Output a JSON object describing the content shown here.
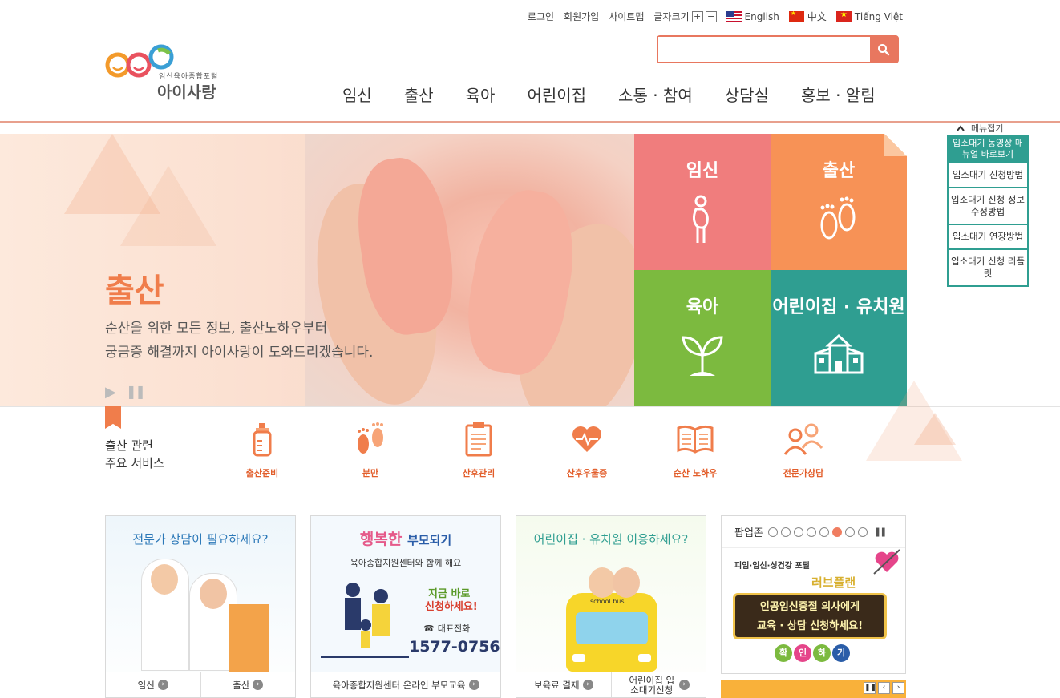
{
  "util": {
    "login": "로그인",
    "signup": "회원가입",
    "sitemap": "사이트맵",
    "fontsize_label": "글자크기",
    "fontsize_plus": "+",
    "fontsize_minus": "−",
    "lang_en": "English",
    "lang_zh": "中文",
    "lang_vi": "Tiếng Việt"
  },
  "search": {
    "placeholder": ""
  },
  "logo": {
    "sub": "임신육아종합포털",
    "name": "아이사랑"
  },
  "gnb": [
    "임신",
    "출산",
    "육아",
    "어린이집",
    "소통 · 참여",
    "상담실",
    "홍보 · 알림"
  ],
  "hero": {
    "title": "출산",
    "desc1": "순산을 위한 모든 정보, 출산노하우부터",
    "desc2": "궁금증 해결까지 아이사랑이 도와드리겠습니다.",
    "play": "▶",
    "pause": "❚❚"
  },
  "tiles": [
    "임신",
    "출산",
    "육아",
    "어린이집 · 유치원"
  ],
  "quick": {
    "toggle": "메뉴접기",
    "head": "입소대기 동영상 매뉴얼 바로보기",
    "items": [
      "입소대기 신청방법",
      "입소대기 신청 정보 수정방법",
      "입소대기 연장방법",
      "입소대기 신청 리플릿"
    ]
  },
  "services": {
    "title1": "출산 관련",
    "title2": "주요 서비스",
    "items": [
      "출산준비",
      "분만",
      "산후관리",
      "산후우울증",
      "순산 노하우",
      "전문가상담"
    ]
  },
  "cards": {
    "c1": {
      "caption": "전문가 상담이 필요하세요?",
      "links": [
        "임신",
        "출산"
      ]
    },
    "c2": {
      "title_a": "행복한",
      "title_b": "부모되기",
      "sub": "육아종합지원센터와 함께 해요",
      "now1": "지금 바로",
      "now2": "신청하세요!",
      "tel_label": "대표전화",
      "tel": "1577-0756",
      "link": "육아종합지원센터 온라인 부모교육"
    },
    "c3": {
      "caption": "어린이집 · 유치원 이용하세요?",
      "bus": "school bus",
      "links": [
        "보육료 결제",
        "어린이집 입소대기신청"
      ]
    }
  },
  "popup": {
    "label": "팝업존",
    "slide_header": "피임·임신·성건강 포털",
    "brand": "러브플랜",
    "msg1": "인공임신중절 의사에게",
    "msg2": "교육 · 상담 신청하세요!",
    "confirm": [
      "확",
      "인",
      "하",
      "기"
    ]
  },
  "colors": {
    "accent": "#e8775f",
    "tile_pink": "#f07d7d",
    "tile_orange": "#f79256",
    "tile_green": "#7cba3f",
    "tile_teal": "#2f9e91",
    "service_orange": "#e25e2b"
  }
}
